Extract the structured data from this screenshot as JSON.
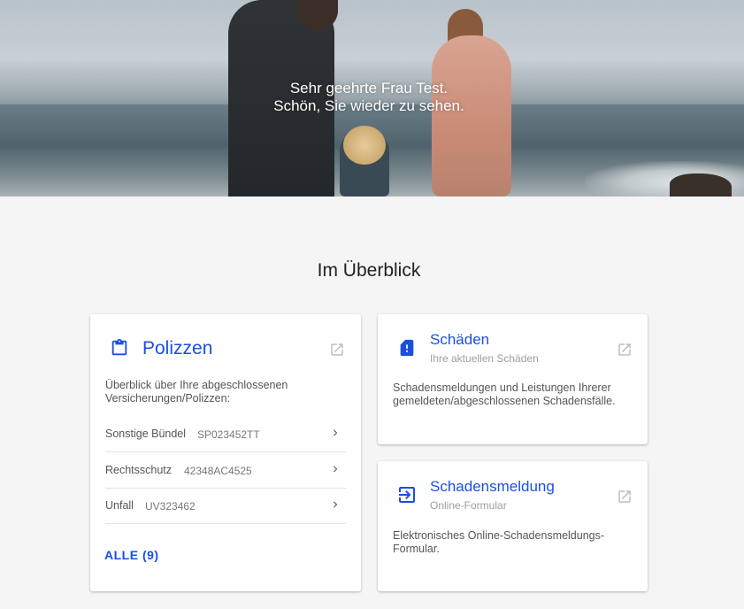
{
  "hero": {
    "greeting_line1": "Sehr geehrte Frau Test.",
    "greeting_line2": "Schön, Sie wieder zu sehen."
  },
  "overview": {
    "title": "Im Überblick"
  },
  "policies_card": {
    "icon": "clipboard-icon",
    "title": "Polizzen",
    "description": "Überblick über Ihre abgeschlossenen Versicherungen/Polizzen:",
    "rows": [
      {
        "name": "Sonstige Bündel",
        "number": "SP023452TT"
      },
      {
        "name": "Rechtsschutz",
        "number": "42348AC4525"
      },
      {
        "name": "Unfall",
        "number": "UV323462"
      }
    ],
    "all_link": "ALLE (9)"
  },
  "claims_card": {
    "icon": "sim-alert-icon",
    "title": "Schäden",
    "subtitle": "Ihre aktuellen Schäden",
    "description": "Schadensmeldungen und Leistungen Ihrerer gemeldeten/abgeschlossenen Schadensfälle."
  },
  "report_card": {
    "icon": "login-icon",
    "title": "Schadensmeldung",
    "subtitle": "Online-Formular",
    "description": "Elektronisches Online-Schadensmeldungs-Formular."
  },
  "colors": {
    "accent": "#1a4fe0",
    "background": "#f5f5f5",
    "card": "#ffffff",
    "muted_icon": "#bdbdbd"
  }
}
